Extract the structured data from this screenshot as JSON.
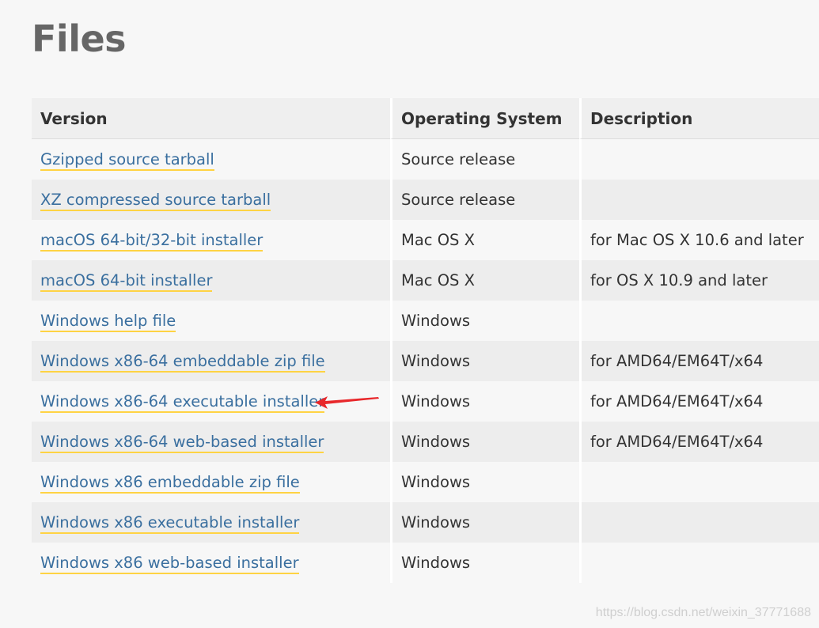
{
  "page": {
    "title": "Files",
    "watermark": "https://blog.csdn.net/weixin_37771688"
  },
  "table": {
    "headers": {
      "version": "Version",
      "os": "Operating System",
      "description": "Description"
    },
    "rows": [
      {
        "version": "Gzipped source tarball",
        "os": "Source release",
        "description": ""
      },
      {
        "version": "XZ compressed source tarball",
        "os": "Source release",
        "description": ""
      },
      {
        "version": "macOS 64-bit/32-bit installer",
        "os": "Mac OS X",
        "description": "for Mac OS X 10.6 and later"
      },
      {
        "version": "macOS 64-bit installer",
        "os": "Mac OS X",
        "description": "for OS X 10.9 and later"
      },
      {
        "version": "Windows help file",
        "os": "Windows",
        "description": ""
      },
      {
        "version": "Windows x86-64 embeddable zip file",
        "os": "Windows",
        "description": "for AMD64/EM64T/x64"
      },
      {
        "version": "Windows x86-64 executable installer",
        "os": "Windows",
        "description": "for AMD64/EM64T/x64"
      },
      {
        "version": "Windows x86-64 web-based installer",
        "os": "Windows",
        "description": "for AMD64/EM64T/x64"
      },
      {
        "version": "Windows x86 embeddable zip file",
        "os": "Windows",
        "description": ""
      },
      {
        "version": "Windows x86 executable installer",
        "os": "Windows",
        "description": ""
      },
      {
        "version": "Windows x86 web-based installer",
        "os": "Windows",
        "description": ""
      }
    ]
  },
  "colors": {
    "link": "#3a6f9f",
    "link_underline": "#ffd343",
    "arrow": "#e8282b",
    "title": "#666666"
  },
  "annotation": {
    "icon": "red-arrow-icon"
  }
}
